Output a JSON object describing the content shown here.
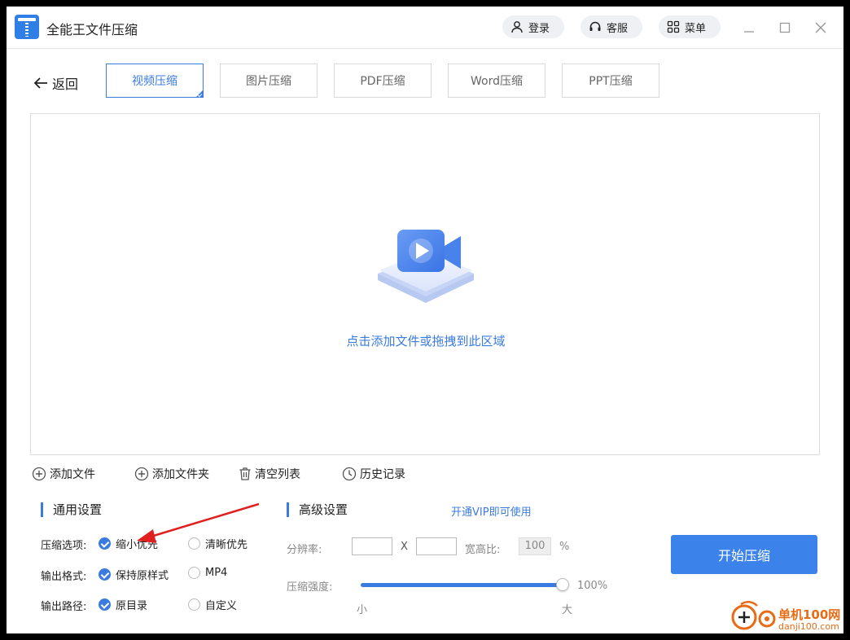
{
  "titlebar": {
    "app_name": "全能王文件压缩",
    "login_label": "登录",
    "service_label": "客服",
    "menu_label": "菜单"
  },
  "nav": {
    "back_label": "返回",
    "tabs": [
      {
        "label": "视频压缩",
        "active": true
      },
      {
        "label": "图片压缩",
        "active": false
      },
      {
        "label": "PDF压缩",
        "active": false
      },
      {
        "label": "Word压缩",
        "active": false
      },
      {
        "label": "PPT压缩",
        "active": false
      }
    ]
  },
  "dropzone": {
    "prompt": "点击添加文件或拖拽到此区域"
  },
  "actions": {
    "add_file": "添加文件",
    "add_folder": "添加文件夹",
    "clear_list": "清空列表",
    "history": "历史记录"
  },
  "general": {
    "title": "通用设置",
    "compress_option_label": "压缩选项:",
    "compress_options": [
      {
        "label": "缩小优先",
        "selected": true
      },
      {
        "label": "清晰优先",
        "selected": false
      }
    ],
    "format_label": "输出格式:",
    "format_options": [
      {
        "label": "保持原样式",
        "selected": true
      },
      {
        "label": "MP4",
        "selected": false
      }
    ],
    "path_label": "输出路径:",
    "path_options": [
      {
        "label": "原目录",
        "selected": true
      },
      {
        "label": "自定义",
        "selected": false
      }
    ]
  },
  "advanced": {
    "title": "高级设置",
    "vip_link": "开通VIP即可使用",
    "resolution_label": "分辨率:",
    "resolution_x": "X",
    "aspect_label": "宽高比:",
    "aspect_value": "100",
    "percent_sign": "%",
    "strength_label": "压缩强度:",
    "strength_value": "100%",
    "strength_fraction": 1.0,
    "min_label": "小",
    "max_label": "大"
  },
  "start_button": "开始压缩",
  "watermark": {
    "name": "单机100网",
    "url": "danji100.com"
  },
  "colors": {
    "accent": "#3a7be0",
    "button": "#3b82ea",
    "watermark": "#e86b16"
  }
}
